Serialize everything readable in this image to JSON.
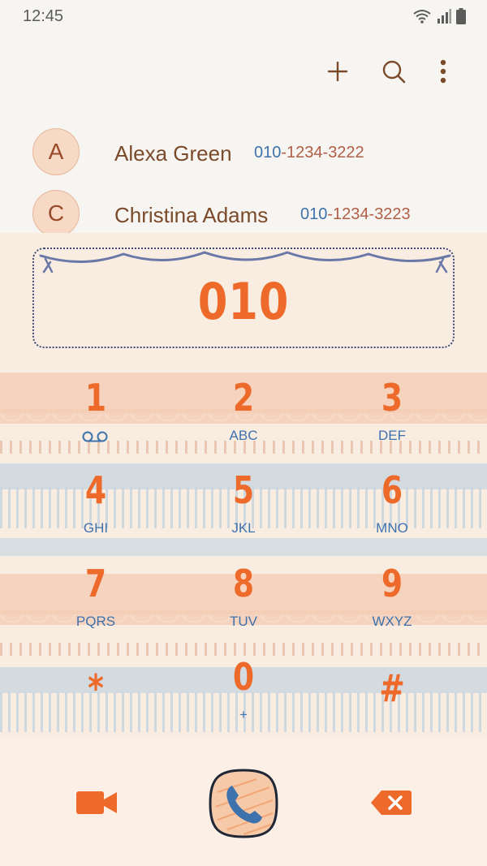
{
  "status_bar": {
    "time": "12:45",
    "icons": [
      "wifi-icon",
      "signal-icon",
      "battery-icon"
    ]
  },
  "toolbar": {
    "actions": [
      "add-icon",
      "search-icon",
      "more-vert-icon"
    ]
  },
  "contacts": [
    {
      "initial": "A",
      "name": "Alexa Green",
      "number_match": "010",
      "number_rest": "-1234-3222"
    },
    {
      "initial": "C",
      "name": "Christina Adams",
      "number_match": "010",
      "number_rest": "-1234-3223"
    }
  ],
  "dialer": {
    "entered_number": "010"
  },
  "keypad": [
    {
      "digit": "1",
      "letters": "",
      "icon": "voicemail-icon"
    },
    {
      "digit": "2",
      "letters": "ABC"
    },
    {
      "digit": "3",
      "letters": "DEF"
    },
    {
      "digit": "4",
      "letters": "GHI"
    },
    {
      "digit": "5",
      "letters": "JKL"
    },
    {
      "digit": "6",
      "letters": "MNO"
    },
    {
      "digit": "7",
      "letters": "PQRS"
    },
    {
      "digit": "8",
      "letters": "TUV"
    },
    {
      "digit": "9",
      "letters": "WXYZ"
    },
    {
      "digit": "*",
      "letters": ""
    },
    {
      "digit": "0",
      "letters": "+"
    },
    {
      "digit": "#",
      "letters": ""
    }
  ],
  "bottom_bar": {
    "actions": [
      "video-call-icon",
      "phone-icon",
      "backspace-icon"
    ]
  },
  "colors": {
    "accent_orange": "#ee6a2a",
    "link_blue": "#3e72ad",
    "contact_name": "#7a4a2a",
    "number_rest": "#b05e46",
    "avatar_bg": "#f6dac6"
  }
}
